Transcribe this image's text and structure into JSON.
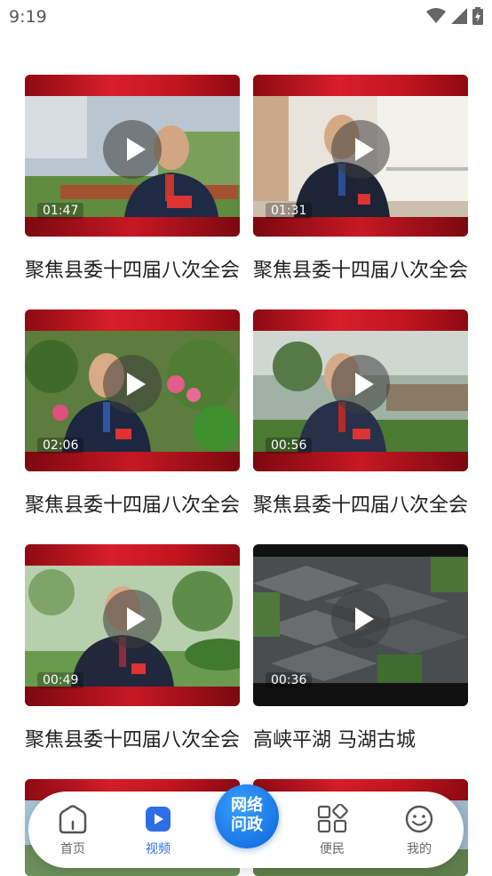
{
  "status_bar": {
    "time": "9:19"
  },
  "videos": [
    {
      "title": "聚焦县委十四届八次全会",
      "duration": "01:47"
    },
    {
      "title": "聚焦县委十四届八次全会",
      "duration": "01:31"
    },
    {
      "title": "聚焦县委十四届八次全会",
      "duration": "02:06"
    },
    {
      "title": "聚焦县委十四届八次全会",
      "duration": "00:56"
    },
    {
      "title": "聚焦县委十四届八次全会",
      "duration": "00:49"
    },
    {
      "title": "高峡平湖 马湖古城",
      "duration": "00:36"
    }
  ],
  "tabbar": {
    "home": "首页",
    "video": "视频",
    "center_line1": "网络",
    "center_line2": "问政",
    "services": "便民",
    "mine": "我的"
  },
  "colors": {
    "accent": "#2d6ee6",
    "brand_red": "#c2151f"
  }
}
